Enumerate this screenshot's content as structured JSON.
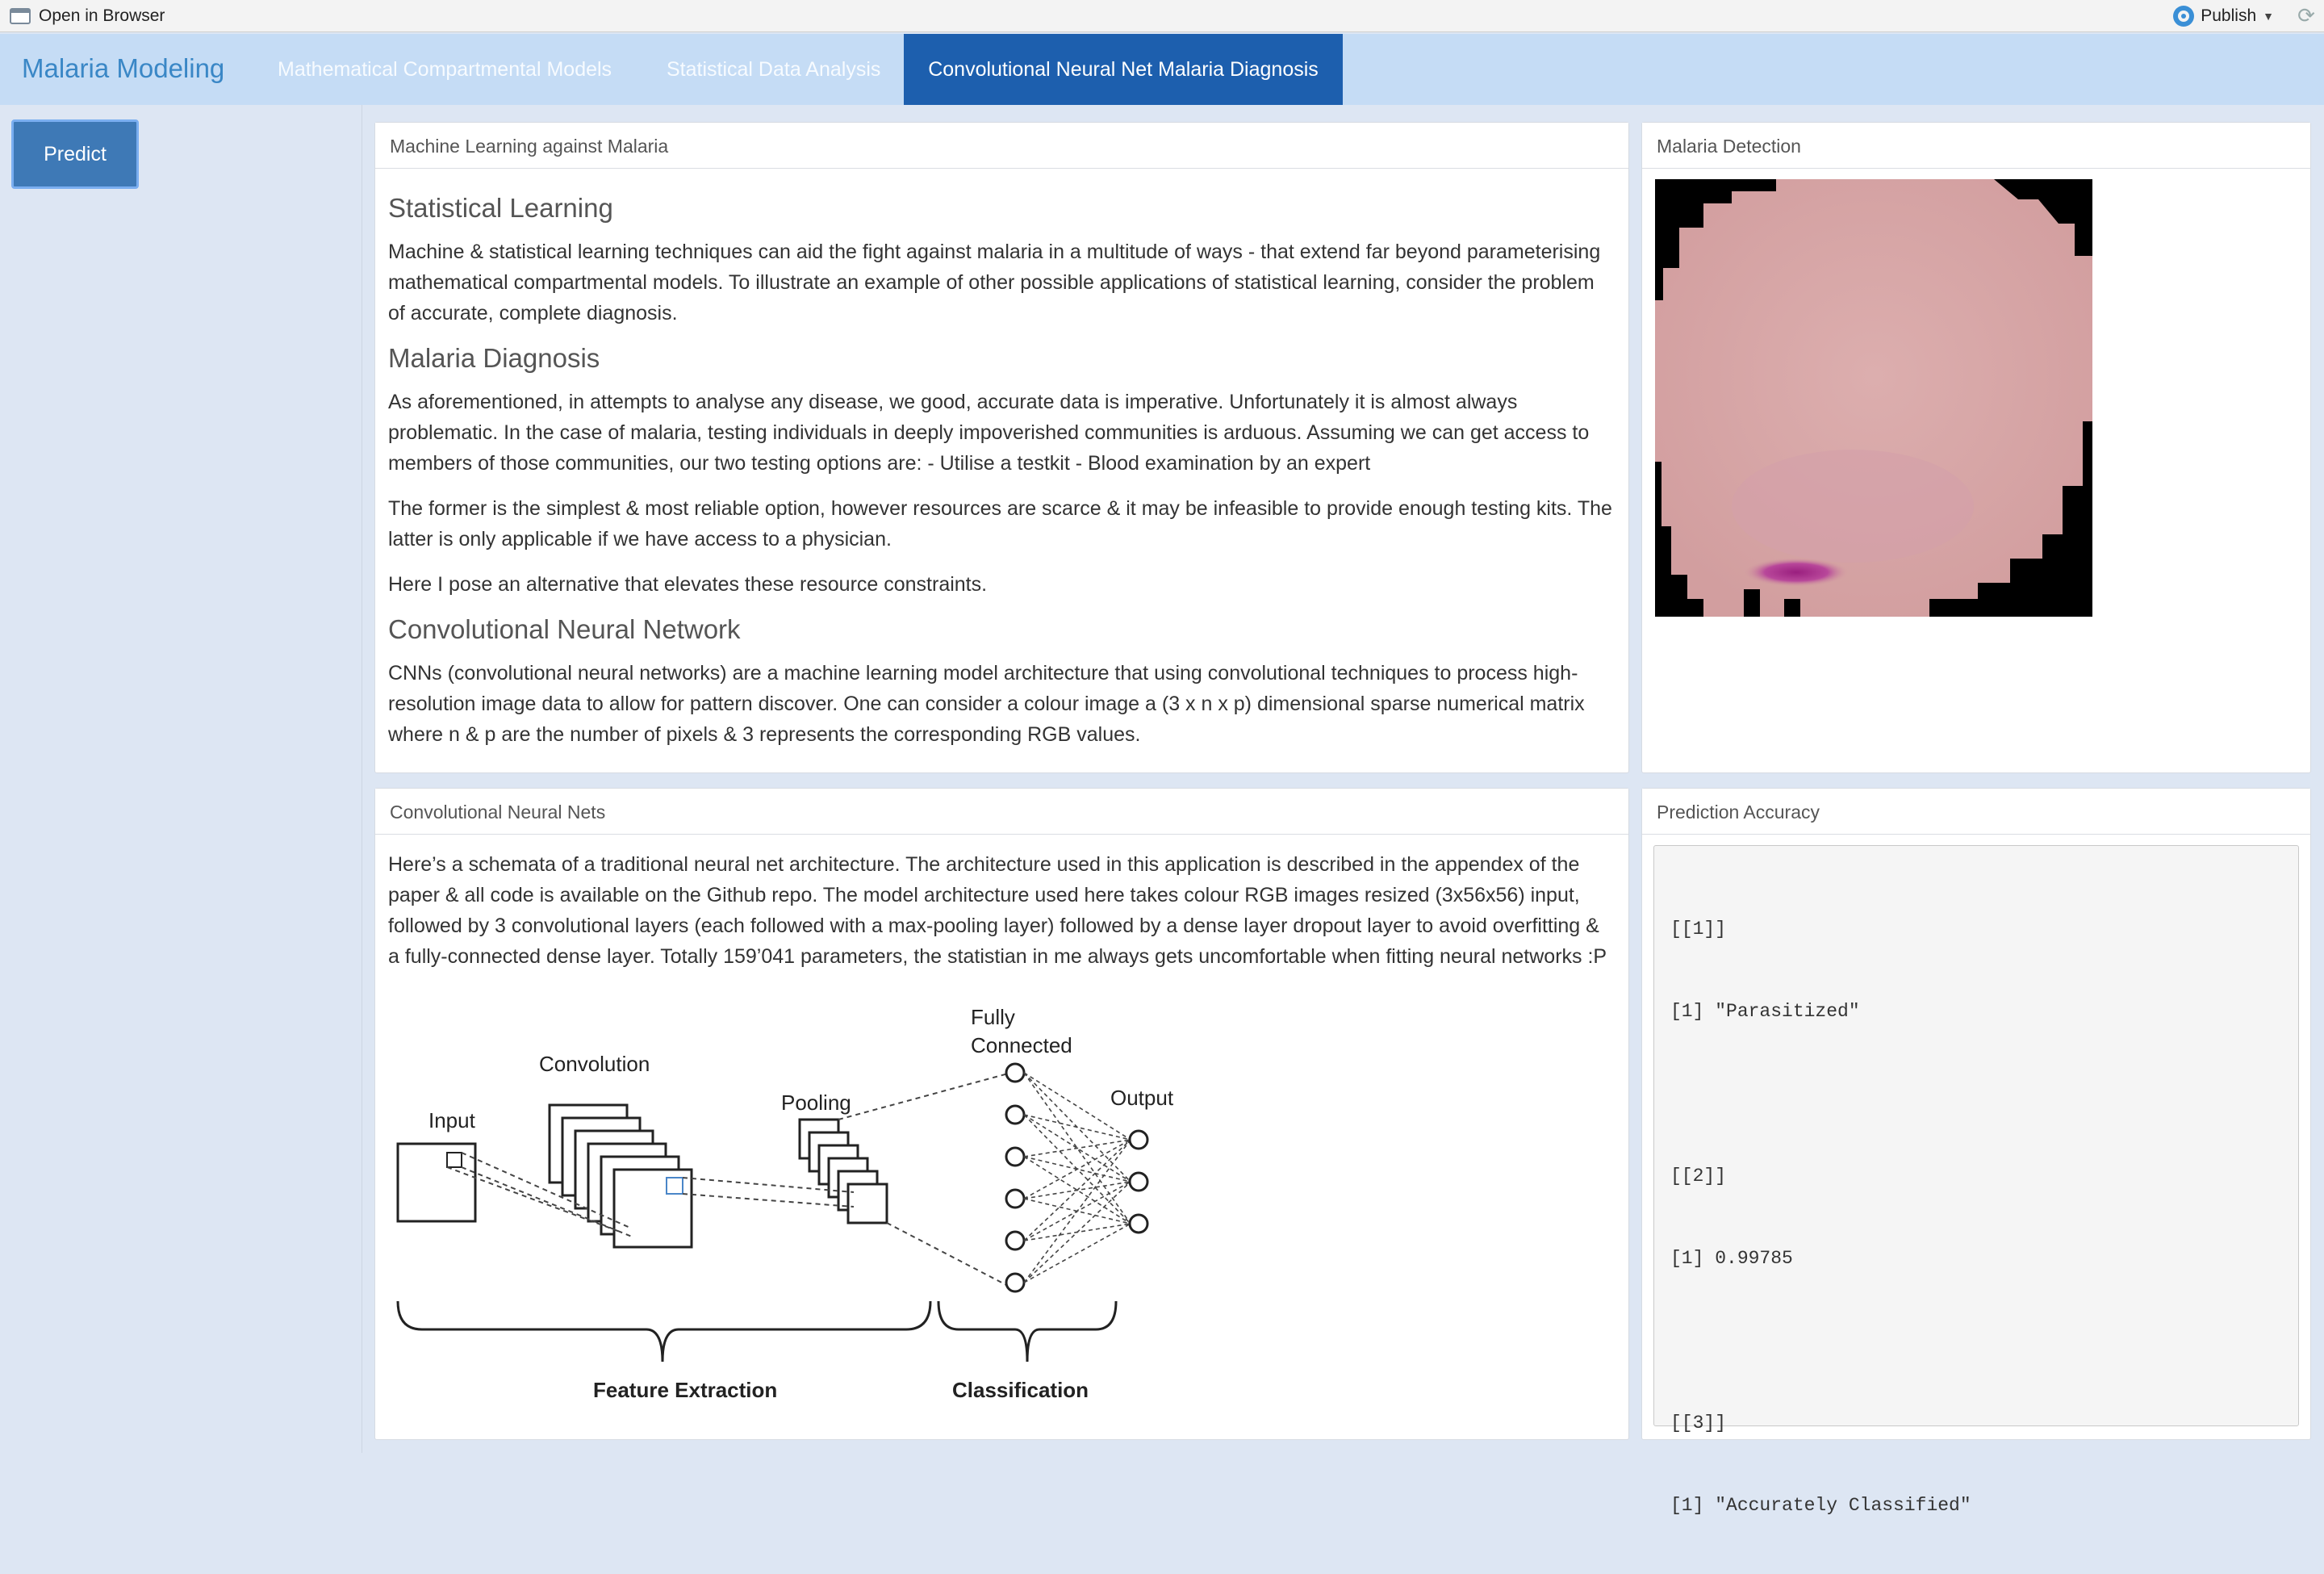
{
  "viewer_bar": {
    "open_in_browser": "Open in Browser",
    "publish": "Publish"
  },
  "navbar": {
    "brand": "Malaria Modeling",
    "tabs": [
      {
        "label": "Mathematical Compartmental Models",
        "active": false
      },
      {
        "label": "Statistical Data Analysis",
        "active": false
      },
      {
        "label": "Convolutional Neural Net Malaria Diagnosis",
        "active": true
      }
    ]
  },
  "sidebar": {
    "predict_button": "Predict"
  },
  "ml_panel": {
    "heading": "Machine Learning against Malaria",
    "sections": [
      {
        "title": "Statistical Learning",
        "paragraphs": [
          "Machine & statistical learning techniques can aid the fight against malaria in a multitude of ways - that extend far beyond parameterising mathematical compartmental models. To illustrate an example of other possible applications of statistical learning, consider the problem of accurate, complete diagnosis."
        ]
      },
      {
        "title": "Malaria Diagnosis",
        "paragraphs": [
          "As aforementioned, in attempts to analyse any disease, we good, accurate data is imperative. Unfortunately it is almost always problematic. In the case of malaria, testing individuals in deeply impoverished communities is arduous. Assuming we can get access to members of those communities, our two testing options are: - Utilise a testkit - Blood examination by an expert",
          "The former is the simplest & most reliable option, however resources are scarce & it may be infeasible to provide enough testing kits. The latter is only applicable if we have access to a physician.",
          "Here I pose an alternative that elevates these resource constraints."
        ]
      },
      {
        "title": "Convolutional Neural Network",
        "paragraphs": [
          "CNNs (convolutional neural networks) are a machine learning model architecture that using convolutional techniques to process high-resolution image data to allow for pattern discover. One can consider a colour image a (3 x n x p) dimensional sparse numerical matrix where n & p are the number of pixels & 3 represents the corresponding RGB values."
        ]
      }
    ]
  },
  "detection_panel": {
    "heading": "Malaria Detection",
    "colors": {
      "cell": "#d9a5a5",
      "stain": "#b0358e",
      "background": "#000000"
    }
  },
  "cnn_panel": {
    "heading": "Convolutional Neural Nets",
    "text": "Here’s a schemata of a traditional neural net architecture. The architecture used in this application is described in the appendex of the paper & all code is available on the Github repo. The model architecture used here takes colour RGB images resized (3x56x56) input, followed by 3 convolutional layers (each followed with a max-pooling layer) followed by a dense layer dropout layer to avoid overfitting & a fully-connected dense layer. Totally 159’041 parameters, the statistian in me always gets uncomfortable when fitting neural networks :P",
    "diagram": {
      "input": "Input",
      "convolution": "Convolution",
      "pooling": "Pooling",
      "fully_connected_1": "Fully",
      "fully_connected_2": "Connected",
      "output": "Output",
      "feature_extraction": "Feature Extraction",
      "classification": "Classification"
    }
  },
  "accuracy_panel": {
    "heading": "Prediction Accuracy",
    "output": [
      [
        "[[1]]",
        "[1] \"Parasitized\""
      ],
      [
        "[[2]]",
        "[1] 0.99785"
      ],
      [
        "[[3]]",
        "[1] \"Accurately Classified\""
      ]
    ]
  }
}
